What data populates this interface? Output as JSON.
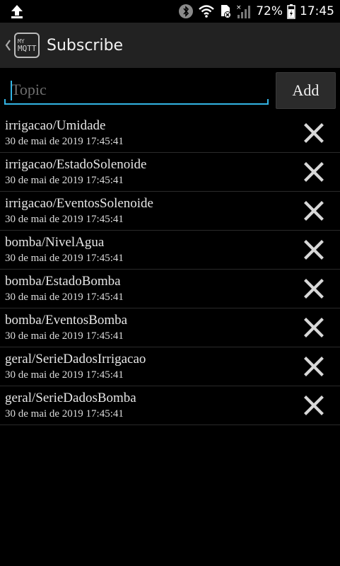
{
  "status_bar": {
    "battery_percent": "72%",
    "time": "17:45"
  },
  "action_bar": {
    "logo_line1": "MY",
    "logo_line2": "MQTT",
    "title": "Subscribe"
  },
  "entry": {
    "topic_placeholder": "Topic",
    "topic_value": "",
    "add_label": "Add"
  },
  "topics": [
    {
      "name": "irrigacao/Umidade",
      "date": "30 de mai de 2019 17:45:41"
    },
    {
      "name": "irrigacao/EstadoSolenoide",
      "date": "30 de mai de 2019 17:45:41"
    },
    {
      "name": "irrigacao/EventosSolenoide",
      "date": "30 de mai de 2019 17:45:41"
    },
    {
      "name": "bomba/NivelAgua",
      "date": "30 de mai de 2019 17:45:41"
    },
    {
      "name": "bomba/EstadoBomba",
      "date": "30 de mai de 2019 17:45:41"
    },
    {
      "name": "bomba/EventosBomba",
      "date": "30 de mai de 2019 17:45:41"
    },
    {
      "name": "geral/SerieDadosIrrigacao",
      "date": "30 de mai de 2019 17:45:41"
    },
    {
      "name": "geral/SerieDadosBomba",
      "date": "30 de mai de 2019 17:45:41"
    }
  ],
  "colors": {
    "accent": "#33b5e5",
    "action_bar": "#222222",
    "background": "#000000"
  }
}
